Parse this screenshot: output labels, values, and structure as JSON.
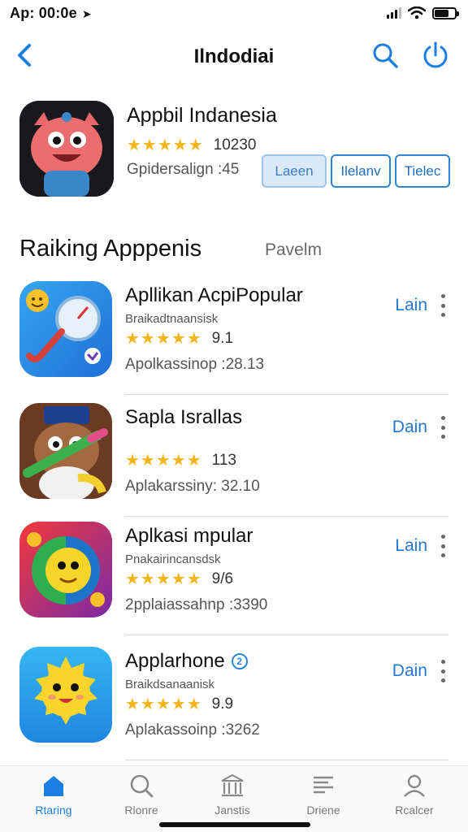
{
  "status_bar": {
    "time": "Ap: 00:0e",
    "signal": "signal-icon",
    "wifi": "wifi-icon",
    "battery": "battery-icon"
  },
  "nav": {
    "title": "Ilndodiai",
    "back_icon": "chevron-left-icon",
    "search_icon": "search-icon",
    "power_icon": "power-icon",
    "accent": "#1a7fe0"
  },
  "featured": {
    "name": "Appbil Indanesia",
    "stars": "★★★★★",
    "rating": "10230",
    "meta": "Gpidersalign :45",
    "actions": [
      "Laeen",
      "Ilelanv",
      "Tielec"
    ],
    "icon": "monster-app-icon"
  },
  "section": {
    "title": "Raiking Apppenis",
    "link": "Pavelm"
  },
  "apps": [
    {
      "name": "Apllikan AcpiPopular",
      "subtitle": "Braikadtnaansisk",
      "stars": "★★★★★",
      "rating": "9.1",
      "meta": "Apolkassinop :28.13",
      "get_label": "Lain",
      "icon": "clock-tool-app-icon"
    },
    {
      "name": "Sapla Israllas",
      "subtitle": "",
      "stars": "★★★★★",
      "rating": "113",
      "meta": "Aplakarssiny: 32.10",
      "get_label": "Dain",
      "icon": "character-crayon-app-icon"
    },
    {
      "name": "Aplkasi mpular",
      "subtitle": "Pnakairincansdsk",
      "stars": "★★★★★",
      "rating": "9/6",
      "meta": "2pplaiassahnp :3390",
      "get_label": "Lain",
      "icon": "yellow-face-app-icon"
    },
    {
      "name": "Applarhone",
      "subtitle": "Braikdsanaanisk",
      "stars": "★★★★★",
      "rating": "9.9",
      "meta": "Aplakassoinp :3262",
      "get_label": "Dain",
      "icon": "sun-character-app-icon"
    }
  ],
  "tabs": [
    {
      "label": "Rtaring",
      "icon": "home-icon",
      "active": true
    },
    {
      "label": "Rlonre",
      "icon": "search-icon",
      "active": false
    },
    {
      "label": "Janstis",
      "icon": "bank-icon",
      "active": false
    },
    {
      "label": "Driene",
      "icon": "list-icon",
      "active": false
    },
    {
      "label": "Rcalcer",
      "icon": "person-icon",
      "active": false
    }
  ],
  "colors": {
    "accent": "#1a7fe0",
    "star": "#f3b51c"
  }
}
